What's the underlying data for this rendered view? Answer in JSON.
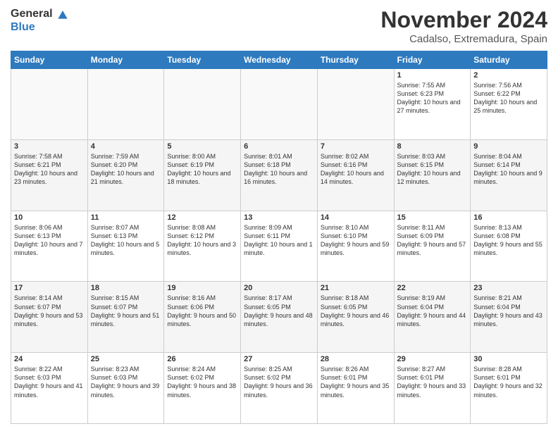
{
  "logo": {
    "general": "General",
    "blue": "Blue"
  },
  "title": "November 2024",
  "location": "Cadalso, Extremadura, Spain",
  "days_of_week": [
    "Sunday",
    "Monday",
    "Tuesday",
    "Wednesday",
    "Thursday",
    "Friday",
    "Saturday"
  ],
  "weeks": [
    [
      {
        "day": "",
        "info": ""
      },
      {
        "day": "",
        "info": ""
      },
      {
        "day": "",
        "info": ""
      },
      {
        "day": "",
        "info": ""
      },
      {
        "day": "",
        "info": ""
      },
      {
        "day": "1",
        "info": "Sunrise: 7:55 AM\nSunset: 6:23 PM\nDaylight: 10 hours and 27 minutes."
      },
      {
        "day": "2",
        "info": "Sunrise: 7:56 AM\nSunset: 6:22 PM\nDaylight: 10 hours and 25 minutes."
      }
    ],
    [
      {
        "day": "3",
        "info": "Sunrise: 7:58 AM\nSunset: 6:21 PM\nDaylight: 10 hours and 23 minutes."
      },
      {
        "day": "4",
        "info": "Sunrise: 7:59 AM\nSunset: 6:20 PM\nDaylight: 10 hours and 21 minutes."
      },
      {
        "day": "5",
        "info": "Sunrise: 8:00 AM\nSunset: 6:19 PM\nDaylight: 10 hours and 18 minutes."
      },
      {
        "day": "6",
        "info": "Sunrise: 8:01 AM\nSunset: 6:18 PM\nDaylight: 10 hours and 16 minutes."
      },
      {
        "day": "7",
        "info": "Sunrise: 8:02 AM\nSunset: 6:16 PM\nDaylight: 10 hours and 14 minutes."
      },
      {
        "day": "8",
        "info": "Sunrise: 8:03 AM\nSunset: 6:15 PM\nDaylight: 10 hours and 12 minutes."
      },
      {
        "day": "9",
        "info": "Sunrise: 8:04 AM\nSunset: 6:14 PM\nDaylight: 10 hours and 9 minutes."
      }
    ],
    [
      {
        "day": "10",
        "info": "Sunrise: 8:06 AM\nSunset: 6:13 PM\nDaylight: 10 hours and 7 minutes."
      },
      {
        "day": "11",
        "info": "Sunrise: 8:07 AM\nSunset: 6:13 PM\nDaylight: 10 hours and 5 minutes."
      },
      {
        "day": "12",
        "info": "Sunrise: 8:08 AM\nSunset: 6:12 PM\nDaylight: 10 hours and 3 minutes."
      },
      {
        "day": "13",
        "info": "Sunrise: 8:09 AM\nSunset: 6:11 PM\nDaylight: 10 hours and 1 minute."
      },
      {
        "day": "14",
        "info": "Sunrise: 8:10 AM\nSunset: 6:10 PM\nDaylight: 9 hours and 59 minutes."
      },
      {
        "day": "15",
        "info": "Sunrise: 8:11 AM\nSunset: 6:09 PM\nDaylight: 9 hours and 57 minutes."
      },
      {
        "day": "16",
        "info": "Sunrise: 8:13 AM\nSunset: 6:08 PM\nDaylight: 9 hours and 55 minutes."
      }
    ],
    [
      {
        "day": "17",
        "info": "Sunrise: 8:14 AM\nSunset: 6:07 PM\nDaylight: 9 hours and 53 minutes."
      },
      {
        "day": "18",
        "info": "Sunrise: 8:15 AM\nSunset: 6:07 PM\nDaylight: 9 hours and 51 minutes."
      },
      {
        "day": "19",
        "info": "Sunrise: 8:16 AM\nSunset: 6:06 PM\nDaylight: 9 hours and 50 minutes."
      },
      {
        "day": "20",
        "info": "Sunrise: 8:17 AM\nSunset: 6:05 PM\nDaylight: 9 hours and 48 minutes."
      },
      {
        "day": "21",
        "info": "Sunrise: 8:18 AM\nSunset: 6:05 PM\nDaylight: 9 hours and 46 minutes."
      },
      {
        "day": "22",
        "info": "Sunrise: 8:19 AM\nSunset: 6:04 PM\nDaylight: 9 hours and 44 minutes."
      },
      {
        "day": "23",
        "info": "Sunrise: 8:21 AM\nSunset: 6:04 PM\nDaylight: 9 hours and 43 minutes."
      }
    ],
    [
      {
        "day": "24",
        "info": "Sunrise: 8:22 AM\nSunset: 6:03 PM\nDaylight: 9 hours and 41 minutes."
      },
      {
        "day": "25",
        "info": "Sunrise: 8:23 AM\nSunset: 6:03 PM\nDaylight: 9 hours and 39 minutes."
      },
      {
        "day": "26",
        "info": "Sunrise: 8:24 AM\nSunset: 6:02 PM\nDaylight: 9 hours and 38 minutes."
      },
      {
        "day": "27",
        "info": "Sunrise: 8:25 AM\nSunset: 6:02 PM\nDaylight: 9 hours and 36 minutes."
      },
      {
        "day": "28",
        "info": "Sunrise: 8:26 AM\nSunset: 6:01 PM\nDaylight: 9 hours and 35 minutes."
      },
      {
        "day": "29",
        "info": "Sunrise: 8:27 AM\nSunset: 6:01 PM\nDaylight: 9 hours and 33 minutes."
      },
      {
        "day": "30",
        "info": "Sunrise: 8:28 AM\nSunset: 6:01 PM\nDaylight: 9 hours and 32 minutes."
      }
    ]
  ]
}
